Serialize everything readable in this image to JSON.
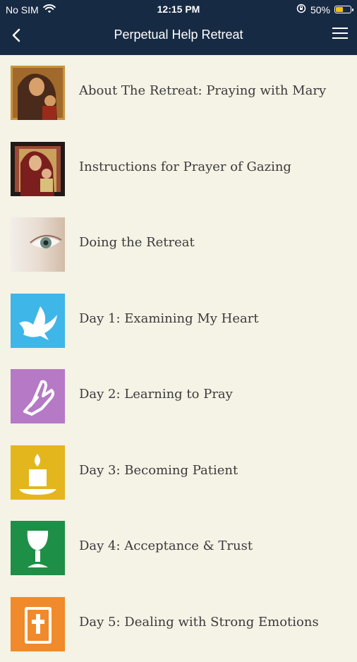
{
  "status": {
    "carrier": "No SIM",
    "time": "12:15 PM",
    "battery": "50%"
  },
  "nav": {
    "title": "Perpetual Help Retreat"
  },
  "items": [
    {
      "label": "About The Retreat: Praying with Mary",
      "icon": "mary-icon-image",
      "color": "#7a4b2a"
    },
    {
      "label": "Instructions for Prayer of Gazing",
      "icon": "icon-image",
      "color": "#8d3b2d"
    },
    {
      "label": "Doing the Retreat",
      "icon": "eye-image",
      "color": "#d7cfc4"
    },
    {
      "label": "Day 1: Examining My Heart",
      "icon": "dove-icon",
      "color": "#3fb6e8"
    },
    {
      "label": "Day 2: Learning to Pray",
      "icon": "praying-hands-icon",
      "color": "#b679c6"
    },
    {
      "label": "Day 3: Becoming Patient",
      "icon": "candle-icon",
      "color": "#e3b61e"
    },
    {
      "label": "Day 4: Acceptance & Trust",
      "icon": "chalice-icon",
      "color": "#1e8f47"
    },
    {
      "label": "Day 5: Dealing with Strong Emotions",
      "icon": "bible-icon",
      "color": "#f08a2a"
    }
  ]
}
